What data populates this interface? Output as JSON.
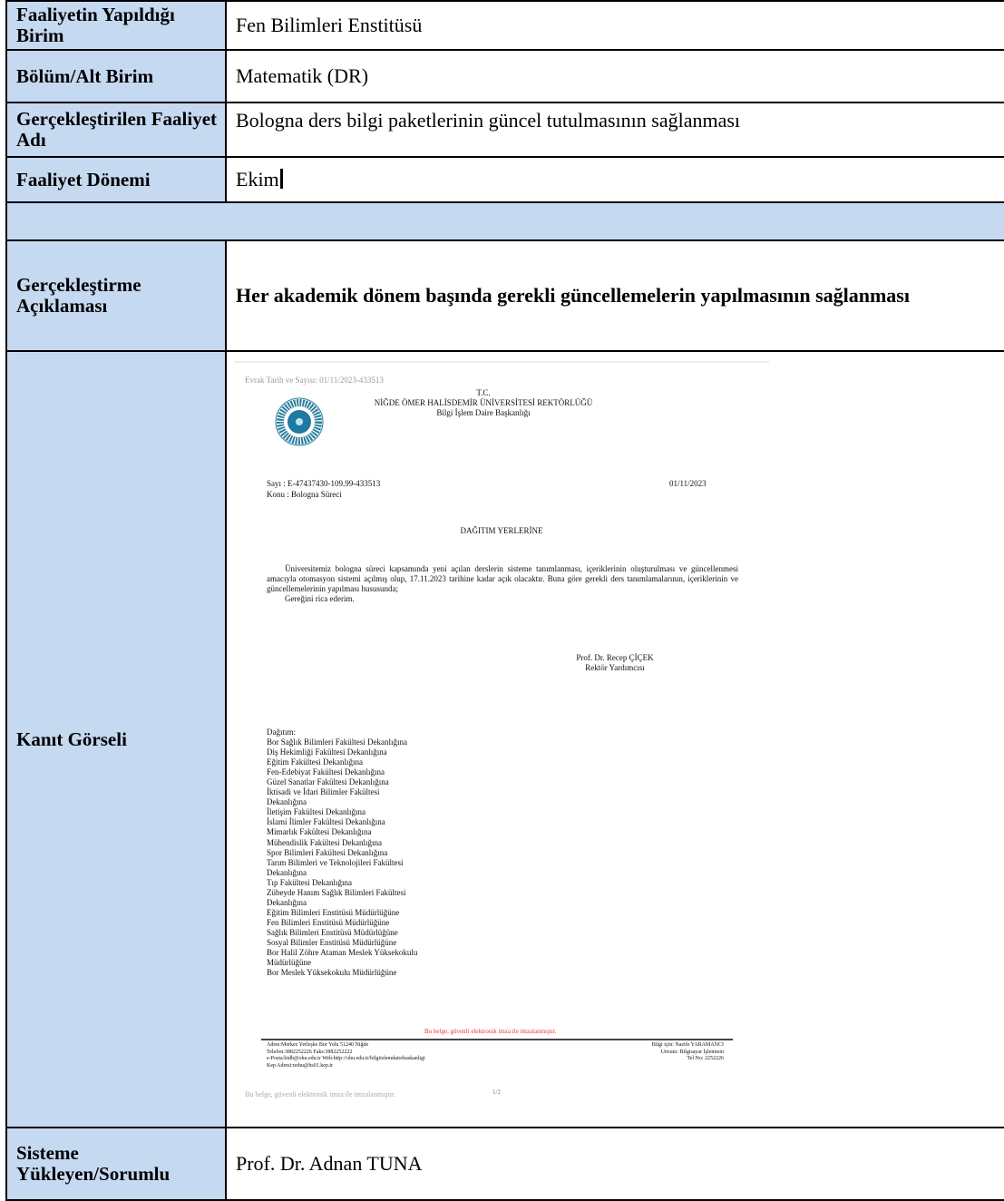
{
  "rows": {
    "birim": {
      "label": "Faaliyetin Yapıldığı Birim",
      "value": "Fen Bilimleri Enstitüsü"
    },
    "bolum": {
      "label": "Bölüm/Alt Birim",
      "value": "Matematik (DR)"
    },
    "faaliyet_adi": {
      "label": "Gerçekleştirilen Faaliyet Adı",
      "value": "Bologna ders bilgi paketlerinin güncel tutulmasının sağlanması"
    },
    "donem": {
      "label": "Faaliyet Dönemi",
      "value": "Ekim"
    },
    "aciklama": {
      "label": "Gerçekleştirme Açıklaması",
      "value": "Her akademik dönem başında gerekli güncellemelerin yapılmasının sağlanması"
    },
    "kanit": {
      "label": "Kanıt Görseli"
    },
    "sorumlu": {
      "label": "Sisteme Yükleyen/Sorumlu",
      "value": "Prof. Dr. Adnan TUNA"
    }
  },
  "letter": {
    "evrak": "Evrak Tarih ve Sayısı: 01/11/2023-433513",
    "tc": "T.C.",
    "university": "NİĞDE ÖMER HALİSDEMİR ÜNİVERSİTESİ REKTÖRLÜĞÜ",
    "department": "Bilgi İşlem Daire Başkanlığı",
    "sayi": "Sayı   : E-47437430-109.99-433513",
    "konu": "Konu  : Bologna Süreci",
    "date": "01/11/2023",
    "recipient": "DAĞITIM YERLERİNE",
    "body": "Üniversitemiz bologna süreci kapsamında yeni açılan derslerin sisteme tanımlanması, içeriklerinin oluşturulması ve güncellenmesi amacıyla otomasyon sistemi açılmış olup, 17.11.2023 tarihine kadar açık olacaktır. Buna göre gerekli ders tanımlamalarının, içeriklerinin ve güncellemelerinin yapılması hususunda;",
    "closing": "Gereğini rica ederim.",
    "signer_name": "Prof. Dr. Recep ÇİÇEK",
    "signer_title": "Rektör Yardımcısı",
    "distribution_title": "Dağıtım:",
    "distribution": [
      "Bor Sağlık Bilimleri Fakültesi Dekanlığına",
      "Diş Hekimliği Fakültesi Dekanlığına",
      "Eğitim Fakültesi Dekanlığına",
      "Fen-Edebiyat Fakültesi Dekanlığına",
      "Güzel Sanatlar Fakültesi Dekanlığına",
      "İktisadi ve İdari Bilimler Fakültesi",
      "Dekanlığına",
      "İletişim Fakültesi Dekanlığına",
      "İslami İlimler Fakültesi Dekanlığına",
      "Mimarlık Fakültesi Dekanlığına",
      "Mühendislik Fakültesi Dekanlığına",
      "Spor Bilimleri Fakültesi Dekanlığına",
      "Tarım Bilimleri ve Teknolojileri Fakültesi",
      "Dekanlığına",
      "Tıp Fakültesi Dekanlığına",
      "Zübeyde Hanım Sağlık Bilimleri Fakültesi",
      "Dekanlığına",
      "Eğitim Bilimleri Enstitüsü Müdürlüğüne",
      "Fen Bilimleri Enstitüsü Müdürlüğüne",
      "Sağlık Bilimleri Enstitüsü Müdürlüğüne",
      "Sosyal Bilimler Enstitüsü Müdürlüğüne",
      "Bor Halil Zöhre Ataman Meslek Yüksekokulu",
      "Müdürlüğüne",
      "Bor Meslek Yüksekokulu Müdürlüğüne"
    ],
    "e_sign_notice": "Bu belge, güvenli elektronik imza ile imzalanmıştır.",
    "footer_left": [
      "Adres:Merkez Yerleşke Bor Yolu 51240 Niğde",
      "Telefon:3882252226 Faks:3882252222",
      "e-Posta:bidb@ohu.edu.tr Web:http://ohu.edu.tr/bilgiislemdairebaskanligi",
      "Kep Adresi:nohu@hs01.kep.tr"
    ],
    "footer_right": [
      "Bilgi için: Nazife YARAMANCI",
      "Unvanı: Bilgisayar İşletmeni",
      "Tel No: 2252226"
    ],
    "bottom_note": "Bu belge, güvenli elektronik imza ile imzalanmıştır.",
    "page": "1/2"
  }
}
